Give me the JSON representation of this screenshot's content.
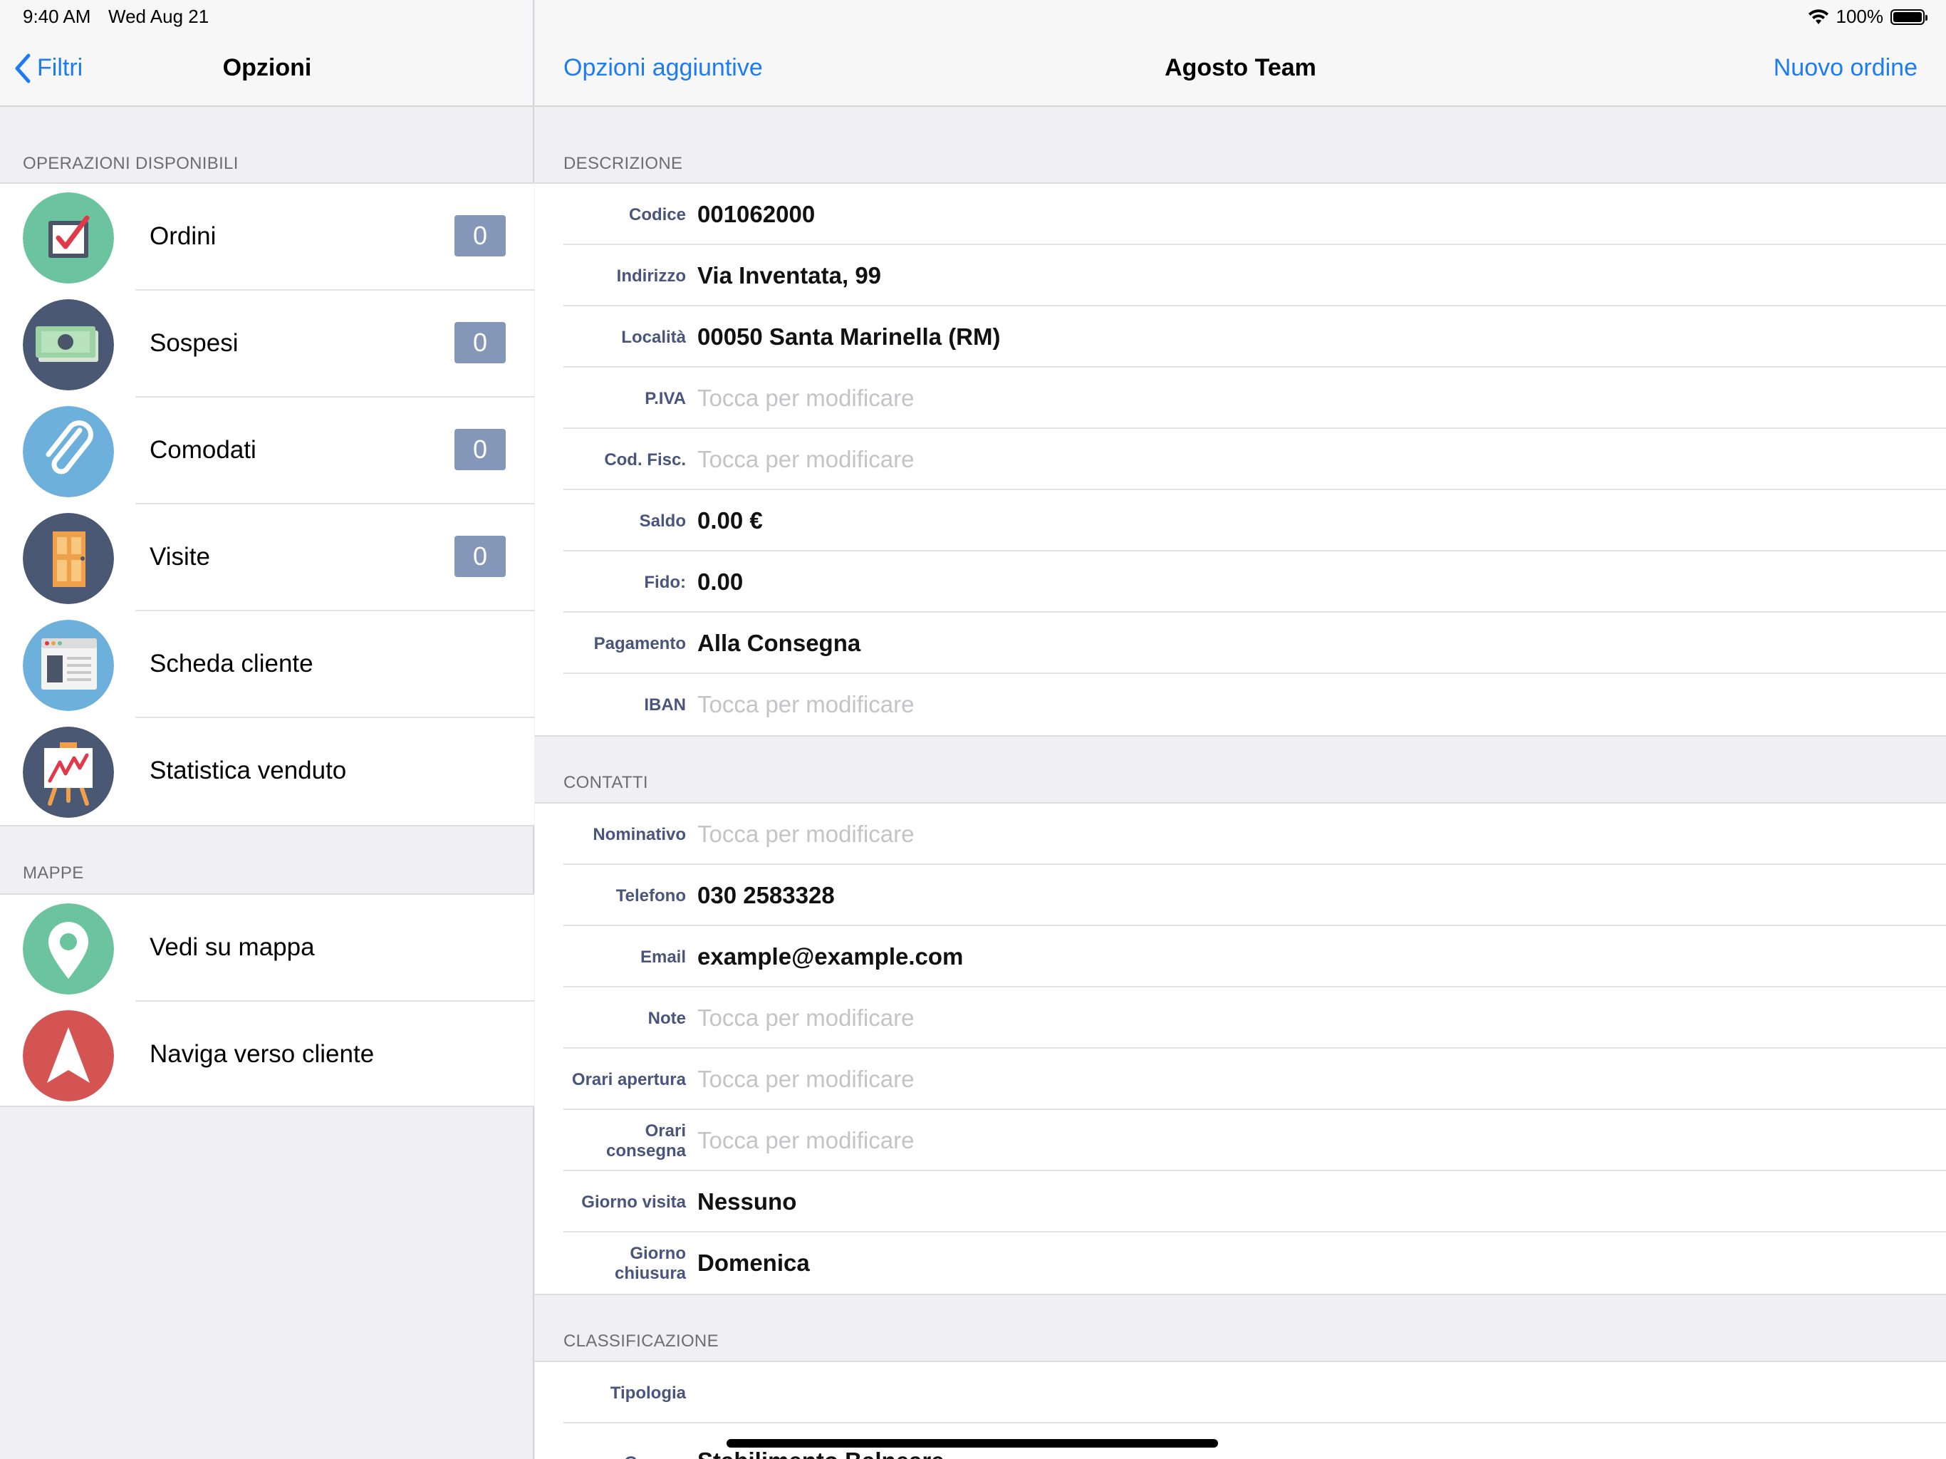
{
  "status": {
    "time": "9:40 AM",
    "date": "Wed Aug 21",
    "battery": "100%"
  },
  "master": {
    "back_label": "Filtri",
    "title": "Opzioni",
    "section_operations": "OPERAZIONI DISPONIBILI",
    "operations": [
      {
        "label": "Ordini",
        "badge": "0",
        "icon": "checkbox-icon"
      },
      {
        "label": "Sospesi",
        "badge": "0",
        "icon": "cash-icon"
      },
      {
        "label": "Comodati",
        "badge": "0",
        "icon": "paperclip-icon"
      },
      {
        "label": "Visite",
        "badge": "0",
        "icon": "door-icon"
      },
      {
        "label": "Scheda cliente",
        "icon": "document-window-icon"
      },
      {
        "label": "Statistica venduto",
        "icon": "easel-chart-icon"
      }
    ],
    "section_maps": "MAPPE",
    "maps": [
      {
        "label": "Vedi su mappa",
        "icon": "map-pin-icon"
      },
      {
        "label": "Naviga verso cliente",
        "icon": "navigation-arrow-icon"
      }
    ]
  },
  "detail": {
    "left_action": "Opzioni aggiuntive",
    "title": "Agosto Team",
    "right_action": "Nuovo ordine",
    "section_description": "DESCRIZIONE",
    "description": [
      {
        "label": "Codice",
        "value": "001062000"
      },
      {
        "label": "Indirizzo",
        "value": "Via Inventata, 99"
      },
      {
        "label": "Località",
        "value": "00050 Santa Marinella (RM)"
      },
      {
        "label": "P.IVA",
        "value": "Tocca per modificare",
        "placeholder": true
      },
      {
        "label": "Cod. Fisc.",
        "value": "Tocca per modificare",
        "placeholder": true
      },
      {
        "label": "Saldo",
        "value": "0.00 €"
      },
      {
        "label": "Fido:",
        "value": "0.00"
      },
      {
        "label": "Pagamento",
        "value": "Alla Consegna"
      },
      {
        "label": "IBAN",
        "value": "Tocca per modificare",
        "placeholder": true
      }
    ],
    "section_contacts": "CONTATTI",
    "contacts": [
      {
        "label": "Nominativo",
        "value": "Tocca per modificare",
        "placeholder": true
      },
      {
        "label": "Telefono",
        "value": "030 2583328"
      },
      {
        "label": "Email",
        "value": "example@example.com"
      },
      {
        "label": "Note",
        "value": "Tocca per modificare",
        "placeholder": true
      },
      {
        "label": "Orari apertura",
        "value": "Tocca per modificare",
        "placeholder": true
      },
      {
        "label": "Orari consegna",
        "value": "Tocca per modificare",
        "placeholder": true
      },
      {
        "label": "Giorno visita",
        "value": "Nessuno"
      },
      {
        "label": "Giorno chiusura",
        "value": "Domenica"
      }
    ],
    "section_classification": "CLASSIFICAZIONE",
    "classification": [
      {
        "label": "Tipologia",
        "value": ""
      },
      {
        "label": "Gruppo",
        "value": "Stabilimento Balneare"
      }
    ]
  },
  "colors": {
    "accent": "#1e7cf0",
    "badge": "#8597b8",
    "label": "#49557a",
    "placeholder": "#c4c4c8"
  }
}
